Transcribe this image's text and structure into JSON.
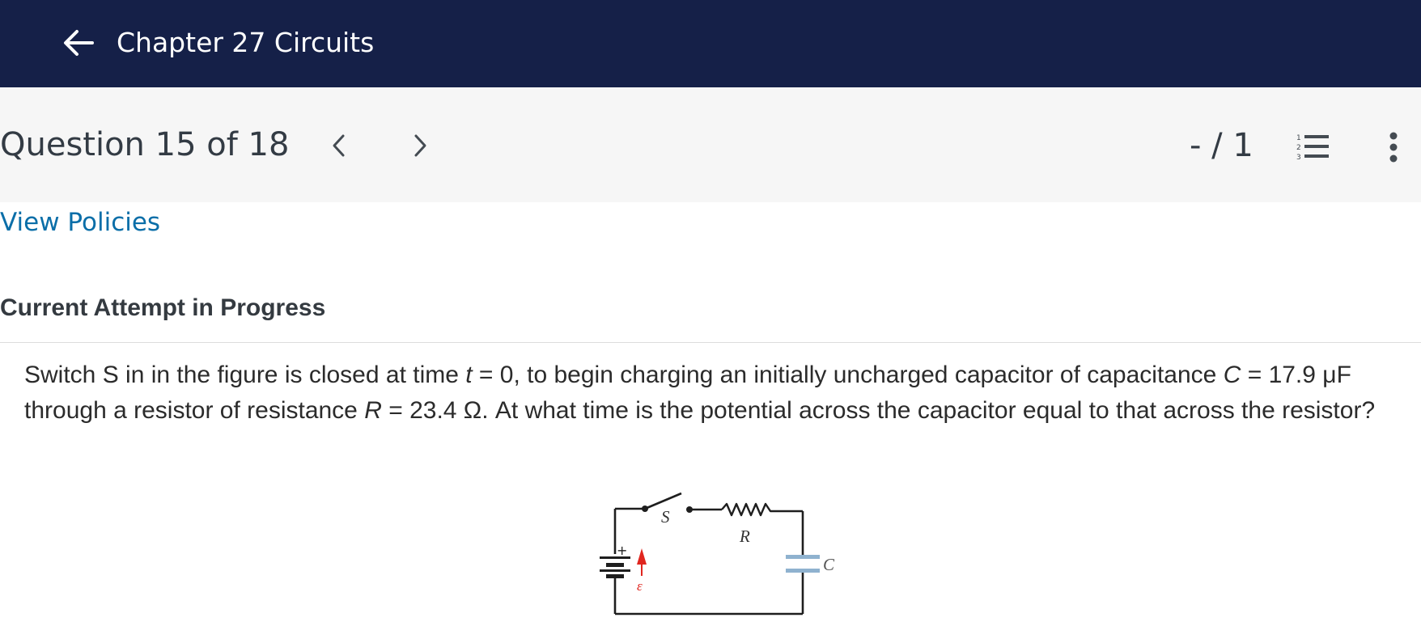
{
  "header": {
    "title": "Chapter 27 Circuits",
    "back_icon": "arrow-left-icon"
  },
  "question_bar": {
    "title": "Question 15 of 18",
    "prev_icon": "chevron-left-icon",
    "next_icon": "chevron-right-icon",
    "score": "- / 1",
    "list_icon": "numbered-list-icon",
    "more_icon": "more-vertical-icon"
  },
  "links": {
    "view_policies": "View Policies"
  },
  "attempt": {
    "heading": "Current Attempt in Progress"
  },
  "question": {
    "part1": "Switch S in in the figure is closed at time ",
    "t_var": "t",
    "part2": " = 0, to begin charging an initially uncharged capacitor of capacitance ",
    "c_var": "C",
    "part3": " = 17.9 μF through a resistor of resistance ",
    "r_var": "R",
    "part4": " = 23.4 Ω. At what time is the potential across the capacitor equal to that across the resistor?"
  },
  "figure": {
    "label_switch": "S",
    "label_resistor": "R",
    "label_capacitor": "C",
    "label_battery_plus": "+",
    "label_emf": "ε",
    "colors": {
      "wire": "#1e1e1e",
      "capacitor": "#8fb2cf",
      "emf_arrow": "#e0261f"
    }
  },
  "colors": {
    "header_bg": "#152048",
    "bar_bg": "#f6f6f6",
    "link": "#0a6ea8"
  }
}
